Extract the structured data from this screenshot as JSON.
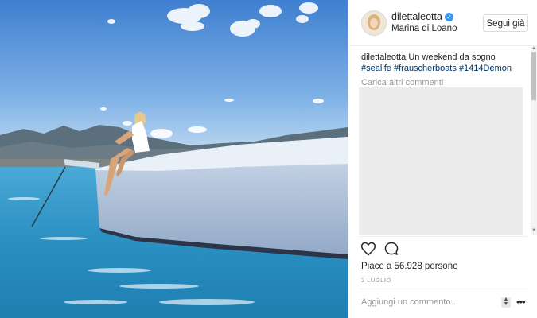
{
  "post": {
    "username": "dilettaleotta",
    "location": "Marina di Loano",
    "follow_label": "Segui già",
    "caption_user": "dilettaleotta",
    "caption_text": " Un weekend da sogno",
    "hashtags": [
      "#sealife",
      "#frauscherboats",
      "#1414Demon"
    ],
    "load_more": "Carica altri commenti",
    "likes": "Piace a 56.928 persone",
    "date": "2 LUGLIO",
    "add_comment_placeholder": "Aggiungi un commento...",
    "more_label": "•••"
  },
  "icons": [
    "heart-icon",
    "comment-icon",
    "verified-badge-icon",
    "more-options-icon"
  ],
  "colors": {
    "link": "#003569",
    "verified": "#3897f0",
    "text": "#262626",
    "muted": "#999999"
  }
}
